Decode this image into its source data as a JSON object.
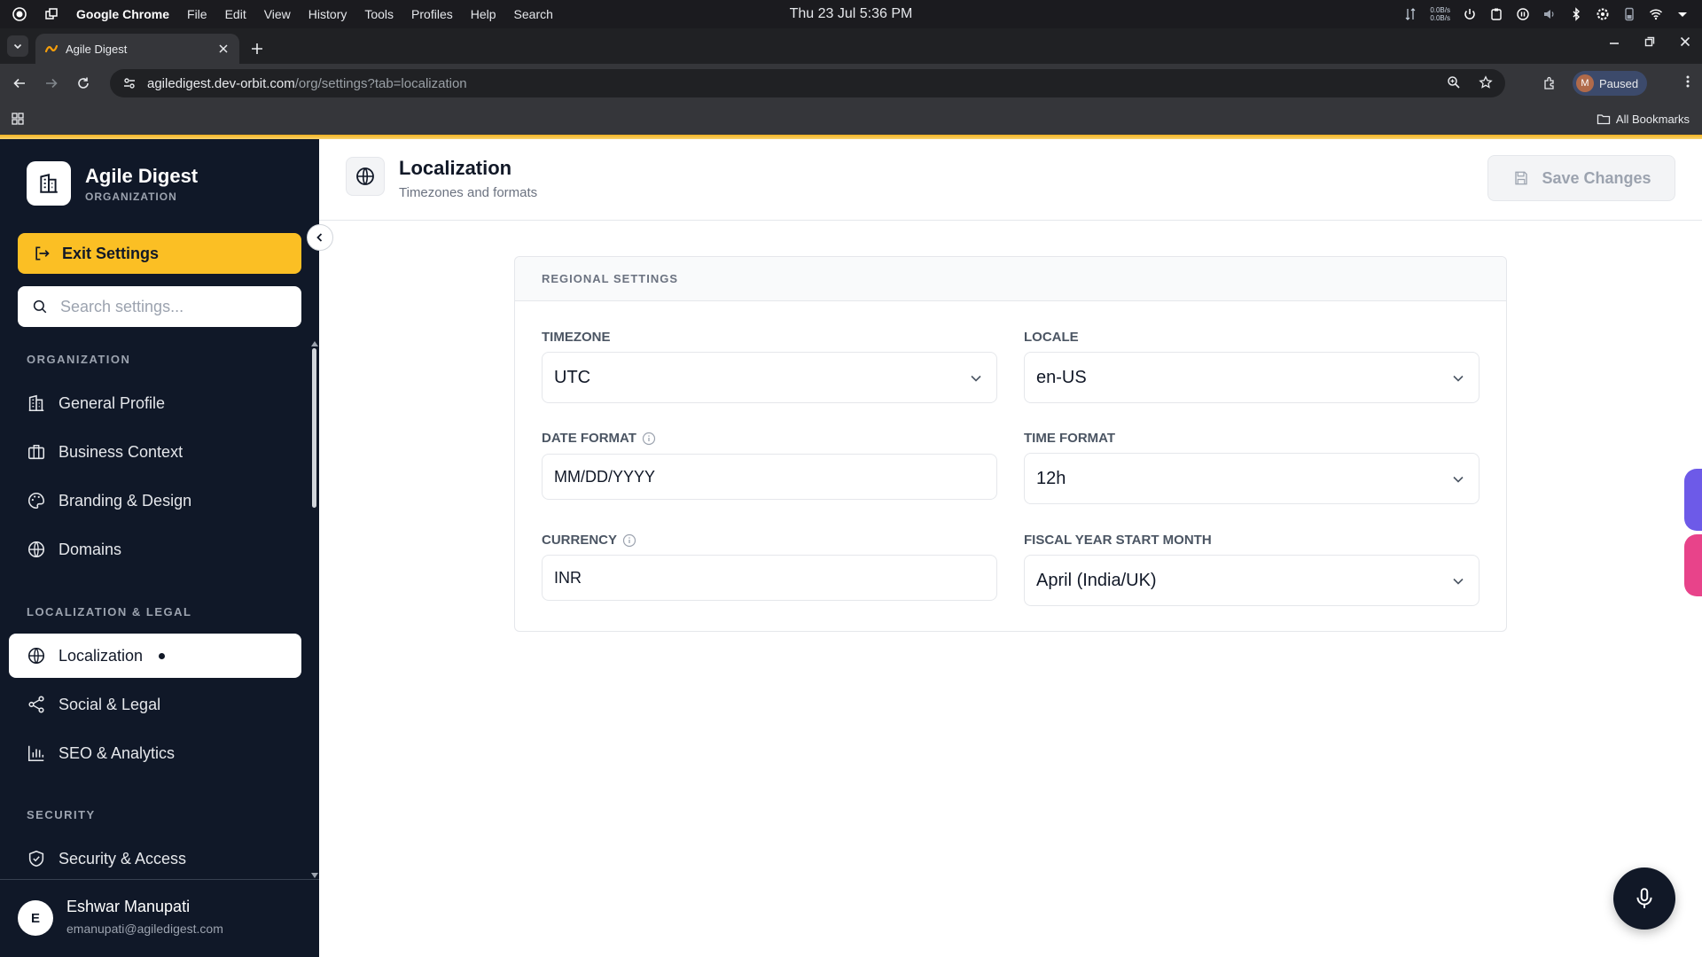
{
  "os": {
    "app_name": "Google Chrome",
    "menus": [
      "File",
      "Edit",
      "View",
      "History",
      "Tools",
      "Profiles",
      "Help",
      "Search"
    ],
    "clock": "Thu 23 Jul  5:36 PM",
    "net_up": "0.0B/s",
    "net_down": "0.0B/s"
  },
  "browser": {
    "tab_title": "Agile Digest",
    "url_host": "agiledigest.dev-orbit.com",
    "url_path": "/org/settings?tab=localization",
    "profile_initial": "M",
    "profile_status": "Paused",
    "bookmarks_label": "All Bookmarks"
  },
  "sidebar": {
    "org_name": "Agile Digest",
    "org_type": "ORGANIZATION",
    "exit_label": "Exit Settings",
    "search_placeholder": "Search settings...",
    "sections": [
      {
        "label": "ORGANIZATION",
        "items": [
          {
            "label": "General Profile",
            "icon": "building-icon"
          },
          {
            "label": "Business Context",
            "icon": "briefcase-icon"
          },
          {
            "label": "Branding & Design",
            "icon": "palette-icon"
          },
          {
            "label": "Domains",
            "icon": "globe-icon"
          }
        ]
      },
      {
        "label": "LOCALIZATION & LEGAL",
        "items": [
          {
            "label": "Localization",
            "icon": "globe-icon",
            "active": true
          },
          {
            "label": "Social & Legal",
            "icon": "share-icon"
          },
          {
            "label": "SEO & Analytics",
            "icon": "bar-chart-icon"
          }
        ]
      },
      {
        "label": "SECURITY",
        "items": [
          {
            "label": "Security & Access",
            "icon": "shield-icon"
          }
        ]
      }
    ],
    "user": {
      "initial": "E",
      "name": "Eshwar Manupati",
      "email": "emanupati@agiledigest.com"
    }
  },
  "header": {
    "title": "Localization",
    "subtitle": "Timezones and formats",
    "save_label": "Save Changes"
  },
  "regional": {
    "section_title": "REGIONAL SETTINGS",
    "timezone": {
      "label": "TIMEZONE",
      "value": "UTC"
    },
    "locale": {
      "label": "LOCALE",
      "value": "en-US"
    },
    "date_format": {
      "label": "DATE FORMAT",
      "value": "MM/DD/YYYY"
    },
    "time_format": {
      "label": "TIME FORMAT",
      "value": "12h"
    },
    "currency": {
      "label": "CURRENCY",
      "value": "INR"
    },
    "fiscal_year": {
      "label": "FISCAL YEAR START MONTH",
      "value": "April (India/UK)"
    }
  },
  "colors": {
    "sidebar_bg": "#101828",
    "accent": "#fbbf24",
    "edge_purple": "#6d5ae8",
    "edge_pink": "#e8438a"
  }
}
